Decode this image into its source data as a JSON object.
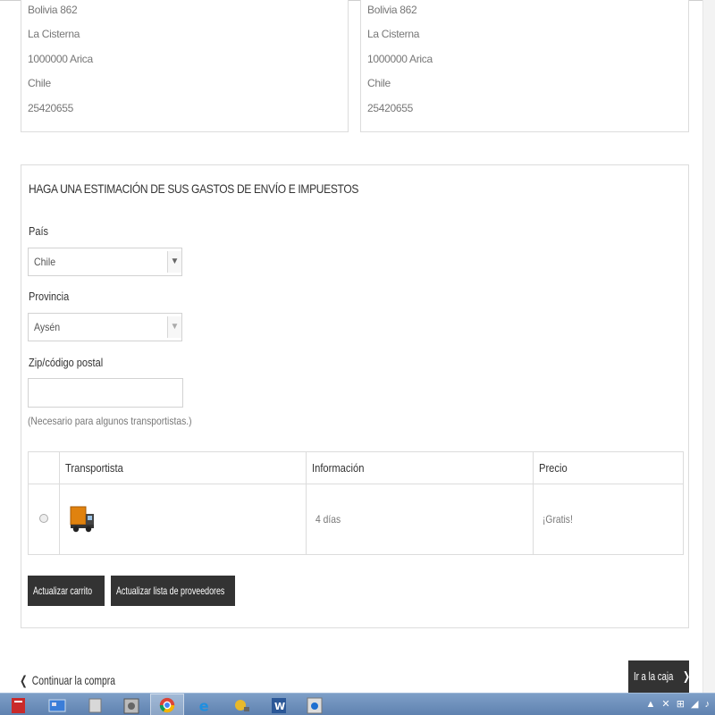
{
  "address_left": [
    "Bolivia 862",
    "La Cisterna",
    "1000000 Arica",
    "Chile",
    "25420655"
  ],
  "address_right": [
    "Bolivia 862",
    "La Cisterna",
    "1000000 Arica",
    "Chile",
    "25420655"
  ],
  "estimate": {
    "title": "Haga una estimación de sus gastos de envío e impuestos",
    "country_label": "País",
    "country_value": "Chile",
    "province_label": "Provincia",
    "province_value": "Aysén",
    "zip_label": "Zip/código postal",
    "zip_value": "",
    "hint": "(Necesario para algunos transportistas.)"
  },
  "carriers": {
    "headers": [
      "Transportista",
      "Información",
      "Precio"
    ],
    "rows": [
      {
        "info": "4 días",
        "price": "¡Gratis!"
      }
    ]
  },
  "buttons": {
    "update_cart": "Actualizar carrito",
    "update_providers": "Actualizar lista de proveedores",
    "arrow": "❯"
  },
  "footer": {
    "continue_arrow": "❮",
    "continue": "Continuar la compra",
    "checkout": "Ir a la caja"
  },
  "taskbar": {
    "items": [
      "pdf-app-icon",
      "explorer-icon",
      "files-icon",
      "archive-icon",
      "chrome-icon",
      "internet-explorer-icon",
      "tools-icon",
      "word-icon",
      "media-icon"
    ],
    "active_index": 4,
    "tray": "▲ ✕ ⊞ ◢ ♪"
  },
  "colors": {
    "button_dark": "#333333",
    "border": "#dcdcdc",
    "taskbar": "#6f90bd"
  }
}
